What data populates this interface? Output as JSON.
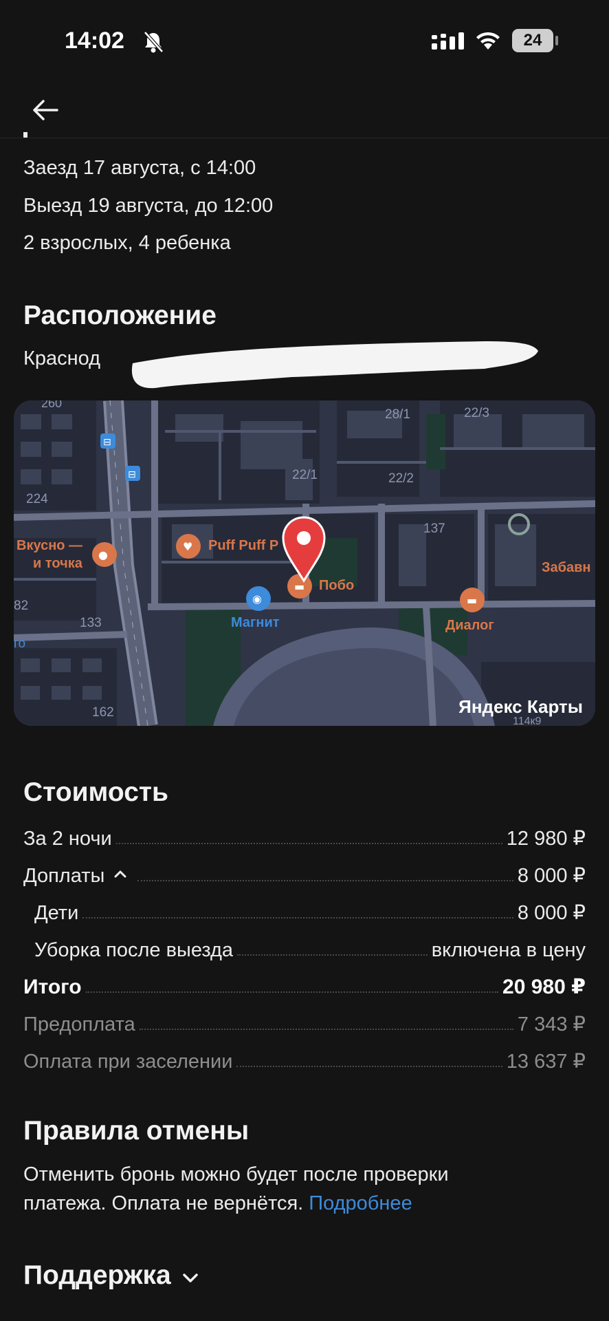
{
  "status": {
    "time": "14:02",
    "battery": "24"
  },
  "booking": {
    "checkin": "Заезд 17 августа, с 14:00",
    "checkout": "Выезд 19 августа, до 12:00",
    "guests": "2 взрослых, 4 ребенка"
  },
  "location": {
    "title": "Расположение",
    "address_visible": "Краснод",
    "map": {
      "brand": "Яндекс Карты",
      "labels": {
        "n260": "260",
        "n28_1": "28/1",
        "n22_3": "22/3",
        "n22_1": "22/1",
        "n22_2": "22/2",
        "n224": "224",
        "n137": "137",
        "n82": "82",
        "n133": "133",
        "n162": "162",
        "n114k9": "114к9",
        "vkusno1": "Вкусно —",
        "vkusno2": "и точка",
        "puff": "Puff Puff P",
        "pobo": "Побо",
        "magnit": "Магнит",
        "dialog": "Диалог",
        "zabav": "Забавн",
        "ro": "го"
      }
    }
  },
  "cost": {
    "title": "Стоимость",
    "rows": [
      {
        "label": "За 2 ночи",
        "value": "12 980 ₽"
      },
      {
        "label": "Доплаты",
        "value": "8 000 ₽"
      },
      {
        "label": "Дети",
        "value": "8 000 ₽"
      },
      {
        "label": "Уборка после выезда",
        "value": "включена в цену"
      },
      {
        "label": "Итого",
        "value": "20 980 ₽"
      },
      {
        "label": "Предоплата",
        "value": "7 343 ₽"
      },
      {
        "label": "Оплата при заселении",
        "value": "13 637 ₽"
      }
    ]
  },
  "cancel": {
    "title": "Правила отмены",
    "text_1": "Отменить бронь можно будет после проверки",
    "text_2": "платежа. Оплата не вернётся.",
    "link": "Подробнее"
  },
  "support": {
    "title": "Поддержка"
  },
  "colors": {
    "background": "#141414",
    "link": "#3d8bdb",
    "pin": "#e53d3d",
    "poi": "#d9774a",
    "map_bg": "#2f3446"
  },
  "icons": [
    "back-arrow-icon",
    "bell-off-icon",
    "signal-icon",
    "wifi-icon",
    "chevron-up-icon",
    "chevron-down-icon",
    "map-pin-icon"
  ]
}
